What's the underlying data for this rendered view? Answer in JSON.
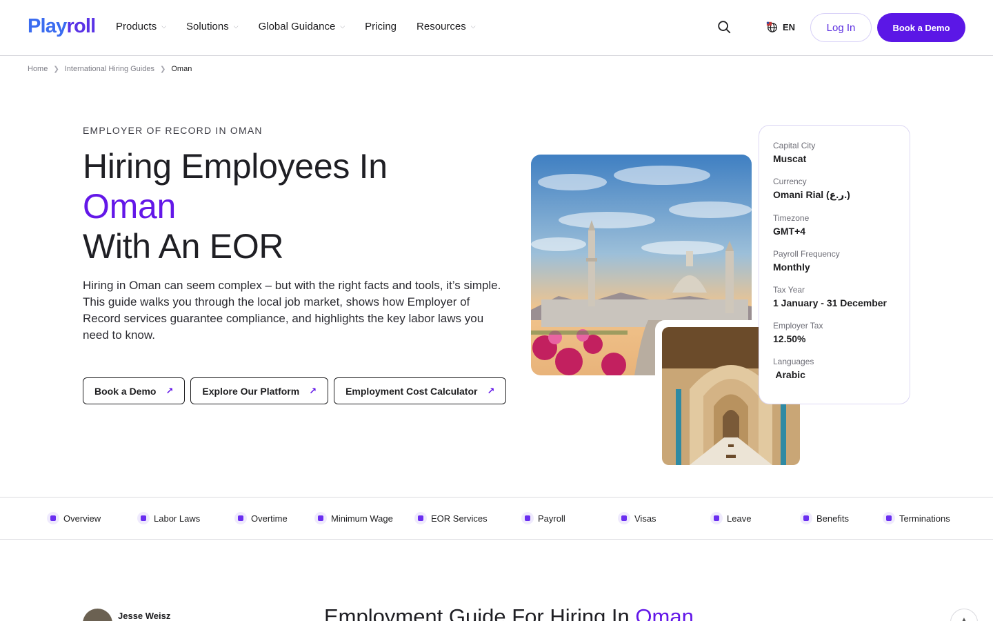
{
  "header": {
    "logo_part1": "Play",
    "logo_part2": "roll",
    "nav": [
      {
        "label": "Products",
        "has_menu": true
      },
      {
        "label": "Solutions",
        "has_menu": true
      },
      {
        "label": "Global Guidance",
        "has_menu": true
      },
      {
        "label": "Pricing",
        "has_menu": false
      },
      {
        "label": "Resources",
        "has_menu": true
      }
    ],
    "search_icon": "search-icon",
    "language": "EN",
    "login_label": "Log In",
    "demo_label": "Book a Demo",
    "accent_color": "#5b17e6"
  },
  "breadcrumb": {
    "items": [
      "Home",
      "International Hiring Guides"
    ],
    "current": "Oman"
  },
  "hero": {
    "eyebrow": "EMPLOYER OF RECORD IN OMAN",
    "title_line1": "Hiring Employees In",
    "title_accent": "Oman",
    "title_line3": "With An EOR",
    "intro": "Hiring in Oman can seem complex – but with the right facts and tools, it’s simple. This guide walks you through the local job market, shows how Employer of Record services guarantee compliance, and highlights the key labor laws you need to know.",
    "ctas": [
      "Book a Demo",
      "Explore Our Platform",
      "Employment Cost Calculator"
    ]
  },
  "facts": [
    {
      "label": "Capital City",
      "value": "Muscat"
    },
    {
      "label": "Currency",
      "value": "Omani Rial (ر.ع.)"
    },
    {
      "label": "Timezone",
      "value": "GMT+4"
    },
    {
      "label": "Payroll Frequency",
      "value": "Monthly"
    },
    {
      "label": "Tax Year",
      "value": "1 January - 31 December"
    },
    {
      "label": "Employer Tax",
      "value": "12.50%"
    },
    {
      "label": "Languages",
      "value": " Arabic"
    }
  ],
  "section_nav": [
    {
      "label": "Overview"
    },
    {
      "label": "Labor Laws"
    },
    {
      "label": "Overtime"
    },
    {
      "label": "Minimum Wage"
    },
    {
      "label": "EOR Services"
    },
    {
      "label": "Payroll"
    },
    {
      "label": "Visas"
    },
    {
      "label": "Leave"
    },
    {
      "label": "Benefits"
    },
    {
      "label": "Terminations"
    }
  ],
  "article": {
    "author": "Jesse Weisz",
    "title_prefix": "Employment Guide For Hiring In",
    "title_accent": "Oman"
  }
}
